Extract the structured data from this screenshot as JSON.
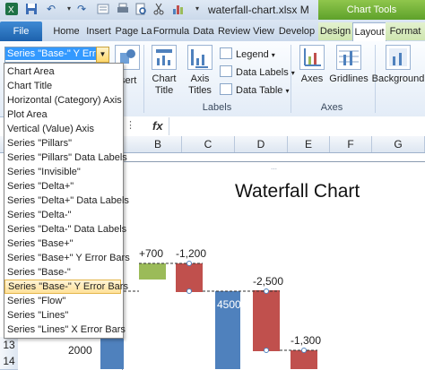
{
  "window": {
    "title": "waterfall-chart.xlsx M",
    "context_tab": "Chart Tools"
  },
  "tabs": [
    {
      "label": "File"
    },
    {
      "label": "Home"
    },
    {
      "label": "Insert"
    },
    {
      "label": "Page La"
    },
    {
      "label": "Formula"
    },
    {
      "label": "Data"
    },
    {
      "label": "Review"
    },
    {
      "label": "View"
    },
    {
      "label": "Develop"
    },
    {
      "label": "Design"
    },
    {
      "label": "Layout"
    },
    {
      "label": "Format"
    }
  ],
  "namebox": {
    "value": "Series \"Base-\" Y Error"
  },
  "element_list": [
    "Chart Area",
    "Chart Title",
    "Horizontal (Category) Axis",
    "Plot Area",
    "Vertical (Value) Axis",
    "Series \"Pillars\"",
    "Series \"Pillars\" Data Labels",
    "Series \"Invisible\"",
    "Series \"Delta+\"",
    "Series \"Delta+\" Data Labels",
    "Series \"Delta-\"",
    "Series \"Delta-\" Data Labels",
    "Series \"Base+\"",
    "Series \"Base+\" Y Error Bars",
    "Series \"Base-\"",
    "Series \"Base-\" Y Error Bars",
    "Series \"Flow\"",
    "Series \"Lines\"",
    "Series \"Lines\" X Error Bars"
  ],
  "selected_item_index": 15,
  "ribbon": {
    "insert_partial": "sert",
    "chart_title": "Chart\nTitle",
    "axis_titles": "Axis\nTitles",
    "legend": "Legend",
    "data_labels": "Data Labels",
    "data_table": "Data Table",
    "axes": "Axes",
    "gridlines": "Gridlines",
    "background": "Background",
    "group_labels": "Labels",
    "group_axes": "Axes"
  },
  "formula_bar": {
    "fx": "fx"
  },
  "columns": [
    "B",
    "C",
    "D",
    "E",
    "F",
    "G"
  ],
  "rows": [
    "13",
    "14"
  ],
  "chart": {
    "title": "Waterfall Chart",
    "labels": [
      "+700",
      "-1,200",
      "4500",
      "-2,500",
      "-1,300",
      "2000"
    ]
  },
  "colors": {
    "pillar": "#4f81bd",
    "delta_plus": "#9bbb59",
    "delta_minus": "#c0504d"
  }
}
